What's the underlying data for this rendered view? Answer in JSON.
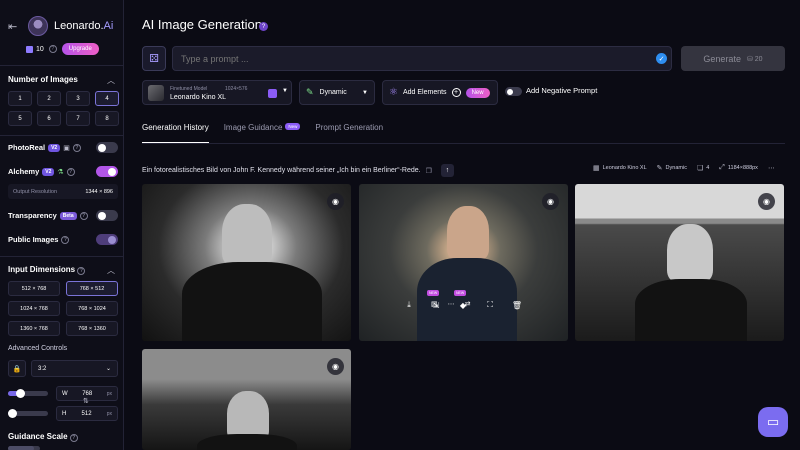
{
  "brand": {
    "name": "Leonardo.",
    "ai": "Ai"
  },
  "account": {
    "tokens": "10",
    "upgrade_label": "Upgrade"
  },
  "sidebar": {
    "num_images": {
      "title": "Number of Images",
      "options": [
        "1",
        "2",
        "3",
        "4",
        "5",
        "6",
        "7",
        "8"
      ],
      "selected": "4"
    },
    "photoreal": {
      "label": "PhotoReal",
      "badge": "V2",
      "enabled": false
    },
    "alchemy": {
      "label": "Alchemy",
      "badge": "V2",
      "enabled": true
    },
    "output_resolution": {
      "label": "Output Resolution",
      "value": "1344 × 896"
    },
    "transparency": {
      "label": "Transparency",
      "badge": "Beta",
      "enabled": false
    },
    "public_images": {
      "label": "Public Images",
      "enabled": true
    },
    "input_dimensions": {
      "title": "Input Dimensions",
      "options": [
        "512 × 768",
        "768 × 512",
        "1024 × 768",
        "768 × 1024",
        "1360 × 768",
        "768 × 1360"
      ],
      "selected": "768 × 512"
    },
    "advanced": {
      "label": "Advanced Controls",
      "aspect_ratio": "3:2",
      "width_label": "W",
      "width": "768",
      "height_label": "H",
      "height": "512",
      "unit": "px"
    },
    "guidance": {
      "title": "Guidance Scale"
    }
  },
  "main": {
    "title": "AI Image Generation",
    "prompt_placeholder": "Type a prompt ...",
    "generate_label": "Generate",
    "generate_cost": "20",
    "model": {
      "small_label": "Finetuned Model",
      "dims": "1024×576",
      "name": "Leonardo Kino XL"
    },
    "style": "Dynamic",
    "elements": {
      "label": "Add Elements",
      "badge": "New"
    },
    "negative_prompt_label": "Add Negative Prompt",
    "tabs": [
      {
        "label": "Generation History",
        "active": true
      },
      {
        "label": "Image Guidance",
        "badge": "New"
      },
      {
        "label": "Prompt Generation"
      }
    ],
    "generation": {
      "prompt": "Ein fotorealistisches Bild von John F. Kennedy während seiner „Ich bin ein Berliner“-Rede.",
      "model": "Leonardo Kino XL",
      "style": "Dynamic",
      "count": "4",
      "size": "1184×888px",
      "overlay_badge_1": "NEW",
      "overlay_badge_2": "NEW"
    }
  },
  "colors": {
    "accent": "#b256e8",
    "background": "#0b0b14",
    "primary_blue": "#2e8ef0"
  }
}
